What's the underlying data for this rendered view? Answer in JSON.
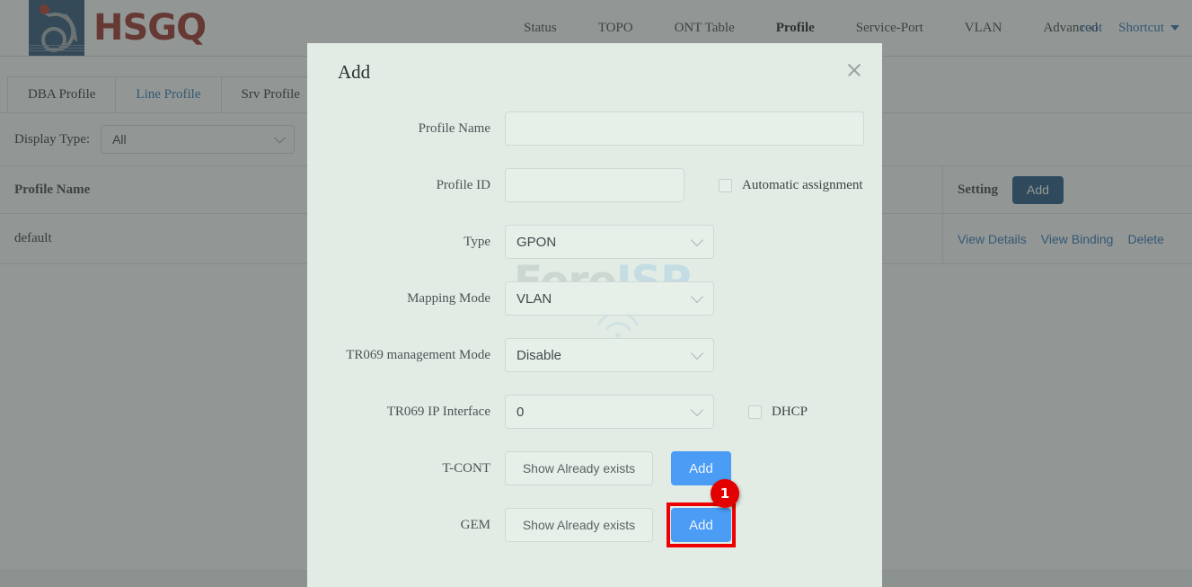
{
  "header": {
    "brand_name": "HSGQ",
    "nav_items": [
      {
        "label": "Status",
        "active": false
      },
      {
        "label": "TOPO",
        "active": false
      },
      {
        "label": "ONT Table",
        "active": false
      },
      {
        "label": "Profile",
        "active": true
      },
      {
        "label": "Service-Port",
        "active": false
      },
      {
        "label": "VLAN",
        "active": false
      },
      {
        "label": "Advanced",
        "active": false
      }
    ],
    "user_label": "root",
    "shortcut_label": "Shortcut"
  },
  "tabs": [
    {
      "label": "DBA Profile",
      "active": false
    },
    {
      "label": "Line Profile",
      "active": true
    },
    {
      "label": "Srv Profile",
      "active": false
    }
  ],
  "filter": {
    "label": "Display Type:",
    "value": "All"
  },
  "table": {
    "columns": [
      "Profile Name",
      "Setting"
    ],
    "add_button": "Add",
    "rows": [
      {
        "profile_name": "default",
        "actions": [
          "View Details",
          "View Binding",
          "Delete"
        ]
      }
    ]
  },
  "modal": {
    "title": "Add",
    "close_icon": "close-icon",
    "watermark": {
      "part1": "Foro",
      "part2": "ISP"
    },
    "fields": {
      "profile_name": {
        "label": "Profile Name",
        "value": "",
        "placeholder": ""
      },
      "profile_id": {
        "label": "Profile ID",
        "value": "",
        "placeholder": ""
      },
      "automatic_assignment": {
        "label": "Automatic assignment",
        "checked": false
      },
      "type": {
        "label": "Type",
        "value": "GPON"
      },
      "mapping_mode": {
        "label": "Mapping Mode",
        "value": "VLAN"
      },
      "tr069_management_mode": {
        "label": "TR069 management Mode",
        "value": "Disable"
      },
      "tr069_ip_interface": {
        "label": "TR069 IP Interface",
        "value": "0"
      },
      "dhcp": {
        "label": "DHCP",
        "checked": false
      },
      "tcont": {
        "label": "T-CONT",
        "show_button": "Show Already exists",
        "add_button": "Add"
      },
      "gem": {
        "label": "GEM",
        "show_button": "Show Already exists",
        "add_button": "Add"
      }
    },
    "highlight": {
      "badge": "1",
      "target": "gem-add-button"
    }
  }
}
